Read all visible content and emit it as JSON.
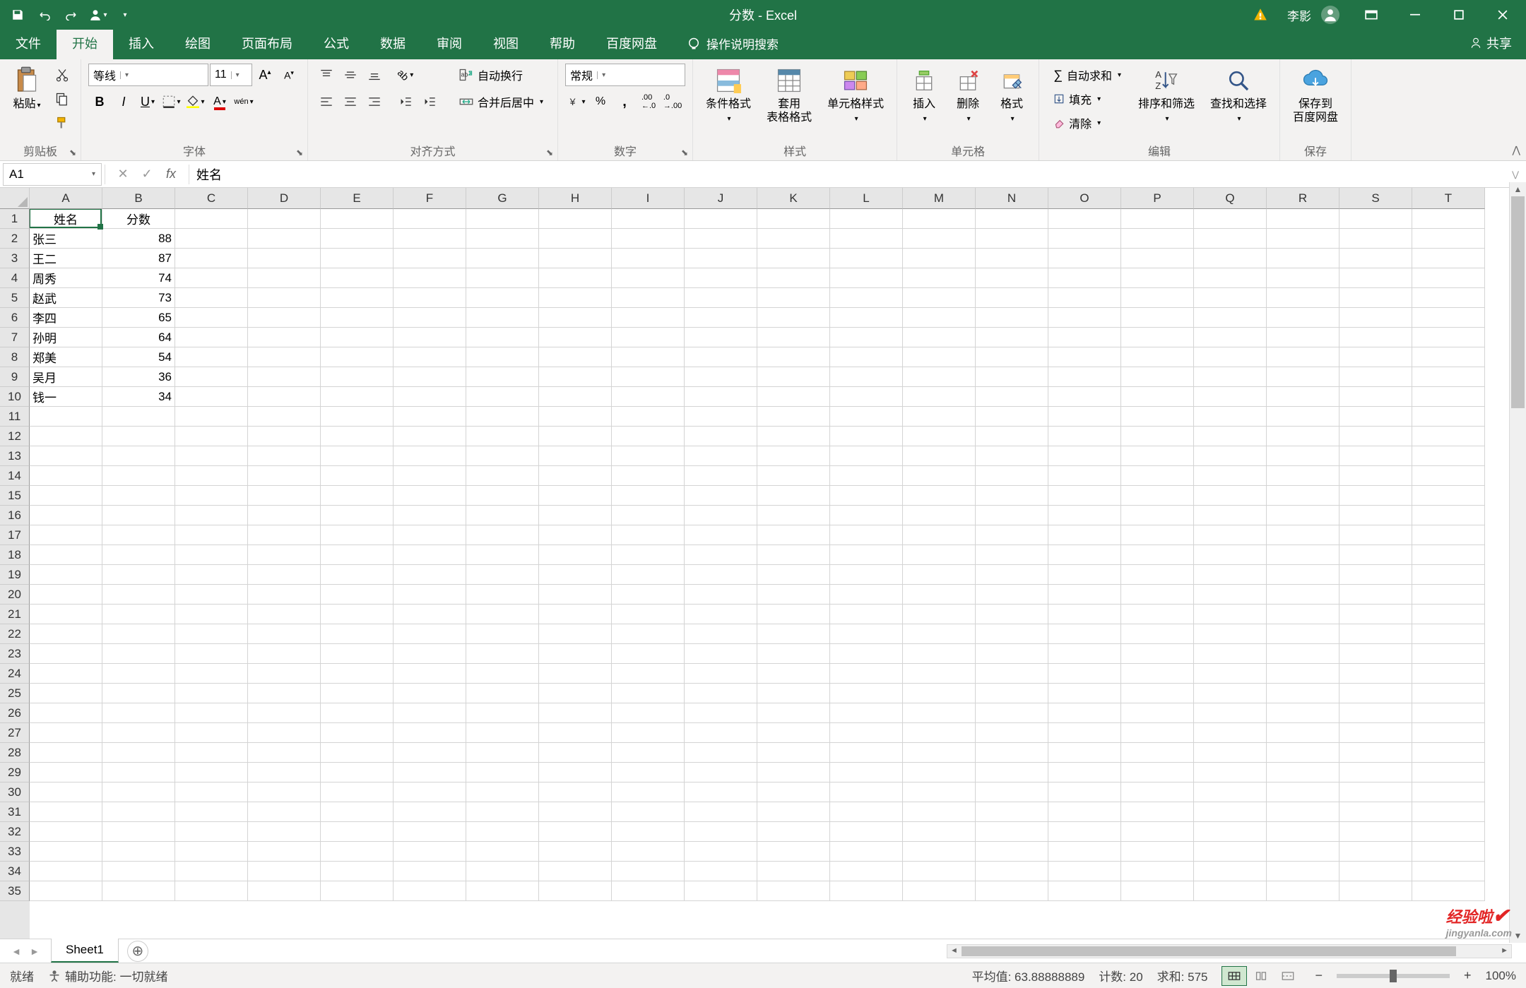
{
  "title": "分数 - Excel",
  "user": "李影",
  "tabs": {
    "file": "文件",
    "home": "开始",
    "insert": "插入",
    "draw": "绘图",
    "pageLayout": "页面布局",
    "formulas": "公式",
    "data": "数据",
    "review": "审阅",
    "view": "视图",
    "help": "帮助",
    "baidu": "百度网盘"
  },
  "tellMe": "操作说明搜索",
  "share": "共享",
  "ribbon": {
    "clipboard": {
      "paste": "粘贴",
      "label": "剪贴板"
    },
    "font": {
      "name": "等线",
      "size": "11",
      "label": "字体"
    },
    "alignment": {
      "wrap": "自动换行",
      "merge": "合并后居中",
      "label": "对齐方式"
    },
    "number": {
      "format": "常规",
      "label": "数字"
    },
    "styles": {
      "conditional": "条件格式",
      "table": "套用\n表格格式",
      "cell": "单元格样式",
      "label": "样式"
    },
    "cells": {
      "insert": "插入",
      "delete": "删除",
      "format": "格式",
      "label": "单元格"
    },
    "editing": {
      "autosum": "自动求和",
      "fill": "填充",
      "clear": "清除",
      "sort": "排序和筛选",
      "find": "查找和选择",
      "label": "编辑"
    },
    "save": {
      "btn": "保存到\n百度网盘",
      "label": "保存"
    }
  },
  "nameBox": "A1",
  "formulaValue": "姓名",
  "columns": [
    "A",
    "B",
    "C",
    "D",
    "E",
    "F",
    "G",
    "H",
    "I",
    "J",
    "K",
    "L",
    "M",
    "N",
    "O",
    "P",
    "Q",
    "R",
    "S",
    "T"
  ],
  "rows": [
    "1",
    "2",
    "3",
    "4",
    "5",
    "6",
    "7",
    "8",
    "9",
    "10",
    "11",
    "12",
    "13",
    "14",
    "15",
    "16",
    "17",
    "18",
    "19",
    "20",
    "21",
    "22",
    "23",
    "24",
    "25",
    "26",
    "27",
    "28",
    "29",
    "30",
    "31",
    "32",
    "33",
    "34",
    "35"
  ],
  "cellData": {
    "A1": "姓名",
    "B1": "分数",
    "A2": "张三",
    "B2": "88",
    "A3": "王二",
    "B3": "87",
    "A4": "周秀",
    "B4": "74",
    "A5": "赵武",
    "B5": "73",
    "A6": "李四",
    "B6": "65",
    "A7": "孙明",
    "B7": "64",
    "A8": "郑美",
    "B8": "54",
    "A9": "吴月",
    "B9": "36",
    "A10": "钱一",
    "B10": "34"
  },
  "sheetTab": "Sheet1",
  "status": {
    "ready": "就绪",
    "accessibility": "辅助功能: 一切就绪",
    "avg": "平均值: 63.88888889",
    "count": "计数: 20",
    "sum": "求和: 575",
    "zoom": "100%"
  },
  "watermark": {
    "big": "经验啦",
    "small": "jingyanla.com"
  }
}
